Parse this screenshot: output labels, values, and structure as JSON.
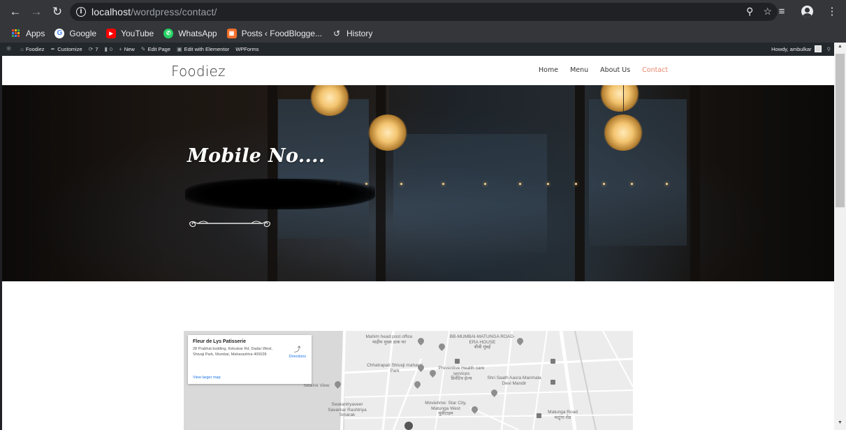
{
  "browser": {
    "url_host": "localhost",
    "url_path": "/wordpress/contact/",
    "bookmarks": [
      {
        "label": "Apps",
        "icon": "apps-grid-icon"
      },
      {
        "label": "Google",
        "icon": "google-icon"
      },
      {
        "label": "YouTube",
        "icon": "youtube-icon"
      },
      {
        "label": "WhatsApp",
        "icon": "whatsapp-icon"
      },
      {
        "label": "Posts ‹ FoodBlogge...",
        "icon": "foodblogger-icon"
      },
      {
        "label": "History",
        "icon": "history-icon"
      }
    ]
  },
  "admin_bar": {
    "site": "Foodiez",
    "customize": "Customize",
    "updates_count": "7",
    "comments_count": "0",
    "new": "New",
    "edit_page": "Edit Page",
    "edit_elementor": "Edit with Elementor",
    "wpforms": "WPForms",
    "howdy": "Howdy, ambulkar"
  },
  "site": {
    "title": "Foodiez",
    "nav": [
      "Home",
      "Menu",
      "About Us",
      "Contact"
    ],
    "active_nav": "Contact",
    "accent_color": "#e8866b"
  },
  "hero": {
    "title": "Mobile No...."
  },
  "map": {
    "place_name": "Fleur de Lys Patisserie",
    "address": "28 Prabhat building, Keluskar Rd, Dadar West, Shivaji Park, Mumbai, Maharashtra 400028",
    "directions": "Directions",
    "view_larger": "View larger map",
    "labels": {
      "mahim_post": "Mahim head post office",
      "mahim_post_local": "माहीम मुख्य डाक घर",
      "bb_mumbai": "BB-MUMBAI-MATUNGA ROAD-ERA HOUSE",
      "bb_mumbai_local": "बीबी मुंबई",
      "chhatrapati": "Chhatrapati Shivaji maharaj Park",
      "preventive": "Preventive Health care services",
      "preventive_local": "प्रिवेंटिव हेल्थ",
      "shri_saath": "Shri Saath Aasra Manmala Devi Mandir",
      "sealink": "Sealink View",
      "swatantryaveer": "Swatantryaveer Savarkar Rashtriya Smarak",
      "movietime": "Movietime: Star City, Matunga West",
      "movietime_local": "मूवीटाइम",
      "matunga_road": "Matunga Road",
      "matunga_road_local": "माटुंगा रोड"
    }
  }
}
